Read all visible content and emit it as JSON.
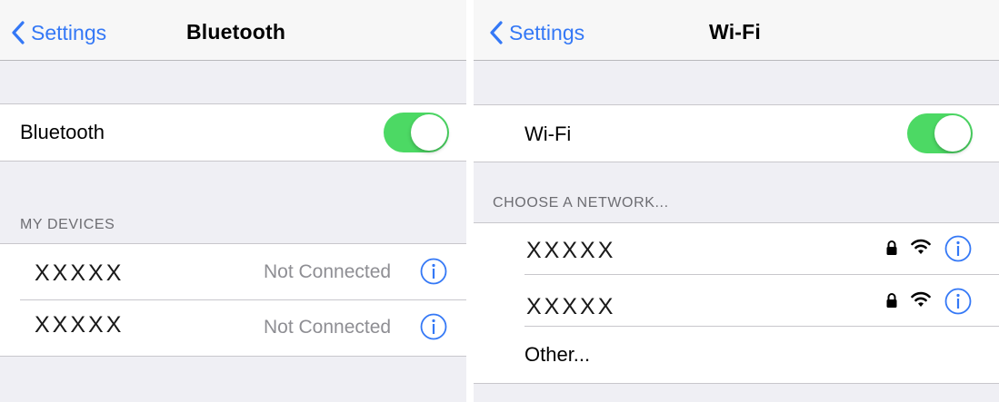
{
  "colors": {
    "accent": "#3478f6",
    "toggle_on": "#4cd964",
    "background": "#efeff4",
    "secondary_text": "#8e8e93"
  },
  "bluetooth": {
    "back_label": "Settings",
    "title": "Bluetooth",
    "toggle_label": "Bluetooth",
    "toggle_on": true,
    "section_header": "MY DEVICES",
    "devices": [
      {
        "name": "XXXXX",
        "status": "Not Connected",
        "icon": "info-icon"
      },
      {
        "name": "XXXXX",
        "status": "Not Connected",
        "icon": "info-icon"
      }
    ]
  },
  "wifi": {
    "back_label": "Settings",
    "title": "Wi-Fi",
    "toggle_label": "Wi-Fi",
    "toggle_on": true,
    "section_header": "CHOOSE A NETWORK...",
    "networks": [
      {
        "name": "XXXXX",
        "icons": [
          "lock-icon",
          "wifi-signal-icon",
          "info-icon"
        ]
      },
      {
        "name": "XXXXX",
        "icons": [
          "lock-icon",
          "wifi-signal-icon",
          "info-icon"
        ]
      }
    ],
    "other_label": "Other..."
  }
}
